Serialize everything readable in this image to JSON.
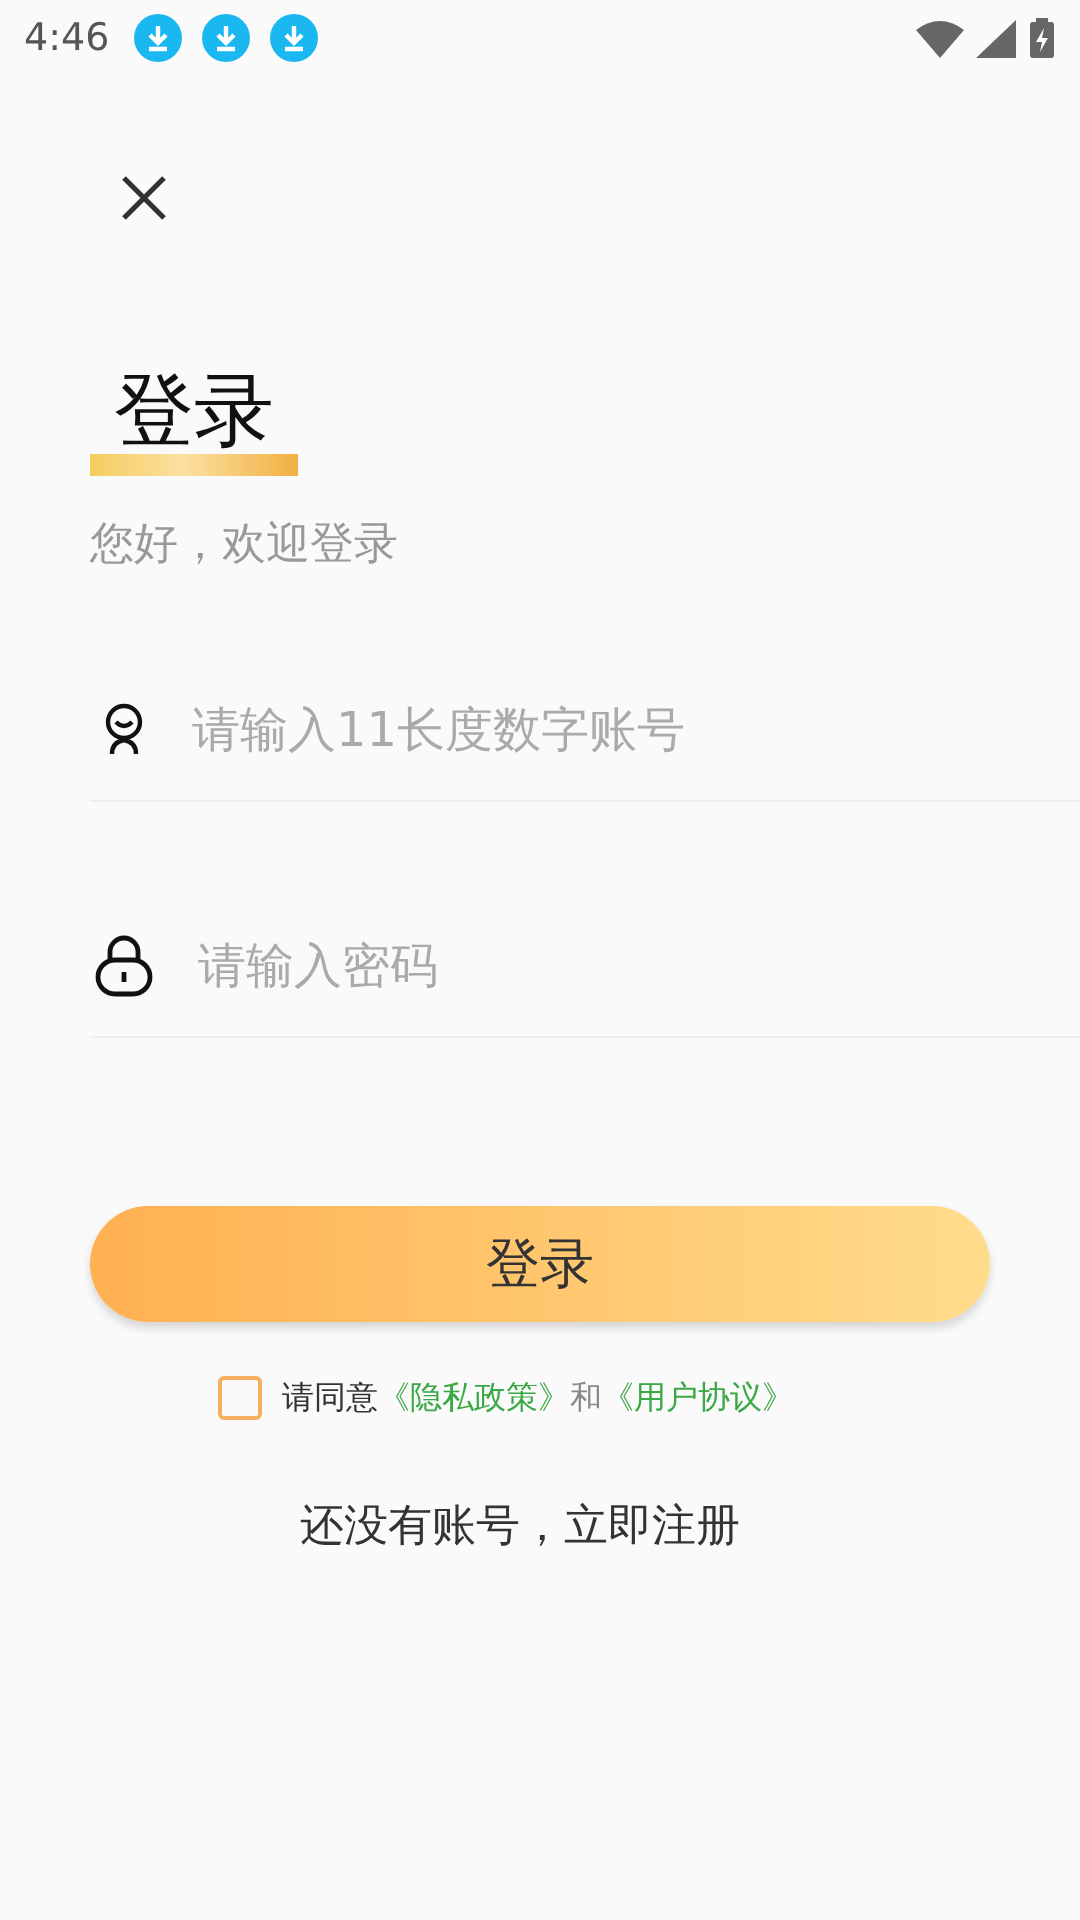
{
  "status_bar": {
    "time": "4:46",
    "notifications": [
      {
        "kind": "download"
      },
      {
        "kind": "download"
      },
      {
        "kind": "download"
      }
    ]
  },
  "title": "登录",
  "subtitle": "您好，欢迎登录",
  "fields": [
    {
      "kind": "account",
      "placeholder": "请输入11长度数字账号"
    },
    {
      "kind": "password",
      "placeholder": "请输入密码"
    }
  ],
  "login_button": "登录",
  "agreement": {
    "checked": false,
    "prefix": "请同意",
    "privacy_link": "《隐私政策》",
    "joiner": "和",
    "terms_link": "《用户协议》"
  },
  "register_link": "还没有账号，立即注册"
}
